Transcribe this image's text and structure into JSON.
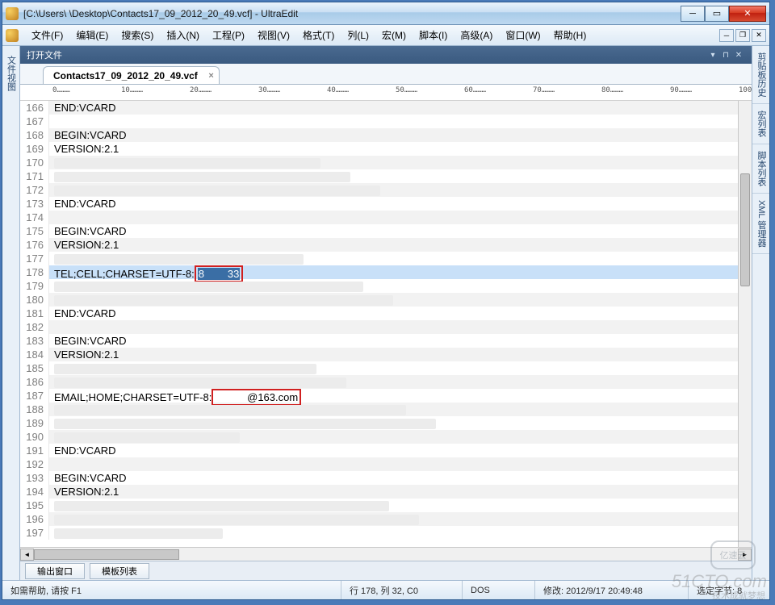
{
  "titlebar": {
    "text": "[C:\\Users\\        \\Desktop\\Contacts17_09_2012_20_49.vcf] - UltraEdit"
  },
  "menu": {
    "items": [
      "文件(F)",
      "编辑(E)",
      "搜索(S)",
      "插入(N)",
      "工程(P)",
      "视图(V)",
      "格式(T)",
      "列(L)",
      "宏(M)",
      "脚本(I)",
      "高级(A)",
      "窗口(W)",
      "帮助(H)"
    ]
  },
  "panel": {
    "title": "打开文件"
  },
  "tab": {
    "label": "Contacts17_09_2012_20_49.vcf"
  },
  "ruler": {
    "ticks": [
      "0",
      "10",
      "20",
      "30",
      "40",
      "50",
      "60",
      "70",
      "80",
      "90",
      "100"
    ]
  },
  "left_rail": {
    "label": "文件视图"
  },
  "right_rail": {
    "tabs": [
      "剪贴板历史",
      "宏列表",
      "脚本列表",
      "XML 管理器"
    ]
  },
  "lines": [
    {
      "n": 166,
      "t": "END:VCARD"
    },
    {
      "n": 167,
      "t": ""
    },
    {
      "n": 168,
      "t": "BEGIN:VCARD"
    },
    {
      "n": 169,
      "t": "VERSION:2.1"
    },
    {
      "n": 170,
      "t": "",
      "blur": true
    },
    {
      "n": 171,
      "t": "",
      "blur": true
    },
    {
      "n": 172,
      "t": "",
      "blur": true
    },
    {
      "n": 173,
      "t": "END:VCARD"
    },
    {
      "n": 174,
      "t": ""
    },
    {
      "n": 175,
      "t": "BEGIN:VCARD"
    },
    {
      "n": 176,
      "t": "VERSION:2.1"
    },
    {
      "n": 177,
      "t": "",
      "blur": true
    },
    {
      "n": 178,
      "t": "TEL;CELL;CHARSET=UTF-8:",
      "special": "sel",
      "sel_a": "8",
      "sel_b": "33"
    },
    {
      "n": 179,
      "t": "",
      "blur": true
    },
    {
      "n": 180,
      "t": "",
      "blur": true
    },
    {
      "n": 181,
      "t": "END:VCARD"
    },
    {
      "n": 182,
      "t": ""
    },
    {
      "n": 183,
      "t": "BEGIN:VCARD"
    },
    {
      "n": 184,
      "t": "VERSION:2.1"
    },
    {
      "n": 185,
      "t": "",
      "blur": true
    },
    {
      "n": 186,
      "t": "",
      "blur": true
    },
    {
      "n": 187,
      "t": "EMAIL;HOME;CHARSET=UTF-8:",
      "special": "email",
      "email": "@163.com"
    },
    {
      "n": 188,
      "t": "",
      "blur": true
    },
    {
      "n": 189,
      "t": "",
      "blur": true
    },
    {
      "n": 190,
      "t": "",
      "blur": true
    },
    {
      "n": 191,
      "t": "END:VCARD"
    },
    {
      "n": 192,
      "t": ""
    },
    {
      "n": 193,
      "t": "BEGIN:VCARD"
    },
    {
      "n": 194,
      "t": "VERSION:2.1"
    },
    {
      "n": 195,
      "t": "",
      "blur": true
    },
    {
      "n": 196,
      "t": "",
      "blur": true
    },
    {
      "n": 197,
      "t": "",
      "blur": true
    }
  ],
  "bottom_tabs": {
    "output": "输出窗口",
    "templates": "模板列表"
  },
  "status": {
    "help": "如需帮助, 请按 F1",
    "pos": "行 178, 列 32, C0",
    "enc": "DOS",
    "mod": "修改: 2012/9/17 20:49:48",
    "sel": "选定字节: 8"
  },
  "watermark": {
    "main": "51CTO.com",
    "sub": "技术成就梦想",
    "logo": "亿速云"
  }
}
